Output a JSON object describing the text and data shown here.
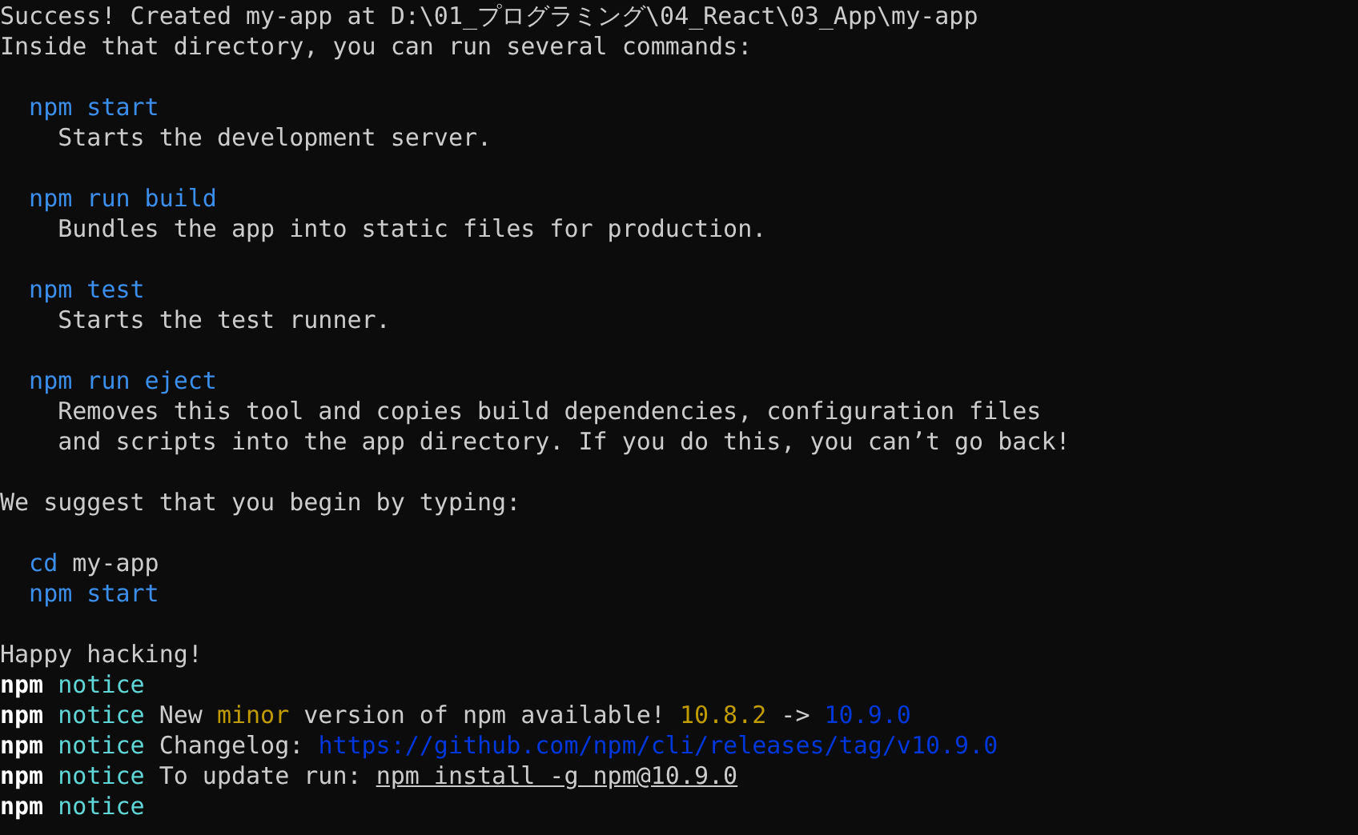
{
  "terminal": {
    "lines": [
      {
        "kind": "text",
        "segments": [
          {
            "kind": "plain",
            "text": "Success! Created my-app at D:\\01_プログラミング\\04_React\\03_App\\my-app"
          }
        ]
      },
      {
        "kind": "text",
        "segments": [
          {
            "kind": "plain",
            "text": "Inside that directory, you can run several commands:"
          }
        ]
      },
      {
        "kind": "blank"
      },
      {
        "kind": "text",
        "segments": [
          {
            "kind": "command",
            "text": "  npm start"
          }
        ]
      },
      {
        "kind": "text",
        "segments": [
          {
            "kind": "plain",
            "text": "    Starts the development server."
          }
        ]
      },
      {
        "kind": "blank"
      },
      {
        "kind": "text",
        "segments": [
          {
            "kind": "command",
            "text": "  npm run build"
          }
        ]
      },
      {
        "kind": "text",
        "segments": [
          {
            "kind": "plain",
            "text": "    Bundles the app into static files for production."
          }
        ]
      },
      {
        "kind": "blank"
      },
      {
        "kind": "text",
        "segments": [
          {
            "kind": "command",
            "text": "  npm test"
          }
        ]
      },
      {
        "kind": "text",
        "segments": [
          {
            "kind": "plain",
            "text": "    Starts the test runner."
          }
        ]
      },
      {
        "kind": "blank"
      },
      {
        "kind": "text",
        "segments": [
          {
            "kind": "command",
            "text": "  npm run eject"
          }
        ]
      },
      {
        "kind": "text",
        "segments": [
          {
            "kind": "plain",
            "text": "    Removes this tool and copies build dependencies, configuration files"
          }
        ]
      },
      {
        "kind": "text",
        "segments": [
          {
            "kind": "plain",
            "text": "    and scripts into the app directory. If you do this, you can’t go back!"
          }
        ]
      },
      {
        "kind": "blank"
      },
      {
        "kind": "text",
        "segments": [
          {
            "kind": "plain",
            "text": "We suggest that you begin by typing:"
          }
        ]
      },
      {
        "kind": "blank"
      },
      {
        "kind": "text",
        "segments": [
          {
            "kind": "command",
            "text": "  cd"
          },
          {
            "kind": "plain",
            "text": " my-app"
          }
        ]
      },
      {
        "kind": "text",
        "segments": [
          {
            "kind": "command",
            "text": "  npm start"
          }
        ]
      },
      {
        "kind": "blank"
      },
      {
        "kind": "text",
        "segments": [
          {
            "kind": "plain",
            "text": "Happy hacking!"
          }
        ]
      },
      {
        "kind": "text",
        "segments": [
          {
            "kind": "bold",
            "text": "npm"
          },
          {
            "kind": "notice",
            "text": " notice"
          }
        ]
      },
      {
        "kind": "text",
        "segments": [
          {
            "kind": "bold",
            "text": "npm"
          },
          {
            "kind": "notice",
            "text": " notice"
          },
          {
            "kind": "plain",
            "text": " New "
          },
          {
            "kind": "yellow",
            "text": "minor"
          },
          {
            "kind": "plain",
            "text": " version of npm available! "
          },
          {
            "kind": "yellow",
            "text": "10.8.2"
          },
          {
            "kind": "plain",
            "text": " -> "
          },
          {
            "kind": "blue",
            "text": "10.9.0"
          }
        ]
      },
      {
        "kind": "text",
        "segments": [
          {
            "kind": "bold",
            "text": "npm"
          },
          {
            "kind": "notice",
            "text": " notice"
          },
          {
            "kind": "plain",
            "text": " Changelog: "
          },
          {
            "kind": "link",
            "text": "https://github.com/npm/cli/releases/tag/v10.9.0"
          }
        ]
      },
      {
        "kind": "text",
        "segments": [
          {
            "kind": "bold",
            "text": "npm"
          },
          {
            "kind": "notice",
            "text": " notice"
          },
          {
            "kind": "plain",
            "text": " To update run: "
          },
          {
            "kind": "underline",
            "text": "npm install -g npm@10.9.0"
          }
        ]
      },
      {
        "kind": "text",
        "segments": [
          {
            "kind": "bold",
            "text": "npm"
          },
          {
            "kind": "notice",
            "text": " notice"
          }
        ]
      }
    ]
  }
}
